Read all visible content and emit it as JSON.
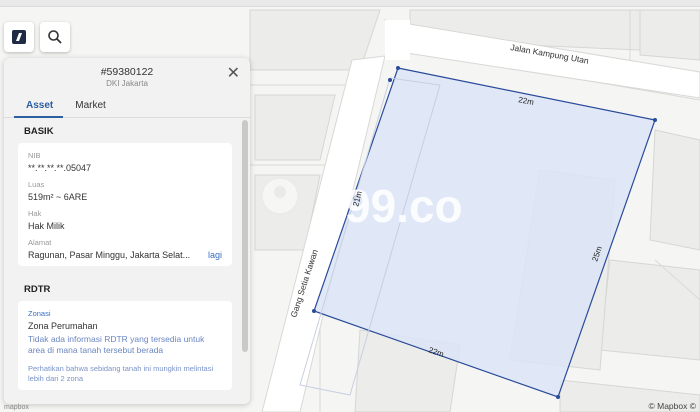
{
  "map": {
    "street_top": "Jalan Kampung Utan",
    "street_left": "Gang Setia Kawan",
    "dim_top": "22m",
    "dim_left": "21m",
    "dim_right": "25m",
    "dim_bottom": "22m",
    "watermark": "99.co",
    "attribution": "© Mapbox ©",
    "attribution_left": "mapbox",
    "colors": {
      "parcel_fill": "#dce5f7",
      "parcel_stroke": "#2a4b9a"
    }
  },
  "tools": {
    "logo_icon": "logo-icon",
    "search_icon": "search-icon"
  },
  "panel": {
    "id": "#59380122",
    "region": "DKI Jakarta",
    "tabs": [
      "Asset",
      "Market"
    ],
    "basik": {
      "title": "BASIK",
      "nib_label": "NIB",
      "nib_value": "**.**.**.**.05047",
      "luas_label": "Luas",
      "luas_value": "519m² ~ 6ARE",
      "hak_label": "Hak",
      "hak_value": "Hak Milik",
      "alamat_label": "Alamat",
      "alamat_value": "Ragunan, Pasar Minggu, Jakarta Selat...",
      "alamat_more": "lagi"
    },
    "rdtr": {
      "title": "RDTR",
      "zonasi_label": "Zonasi",
      "zonasi_value": "Zona Perumahan",
      "info": "Tidak ada informasi RDTR yang tersedia untuk area di mana tanah tersebut berada",
      "note": "Perhatikan bahwa sebidang tanah ini mungkin melintasi lebih dari 2 zona"
    }
  }
}
